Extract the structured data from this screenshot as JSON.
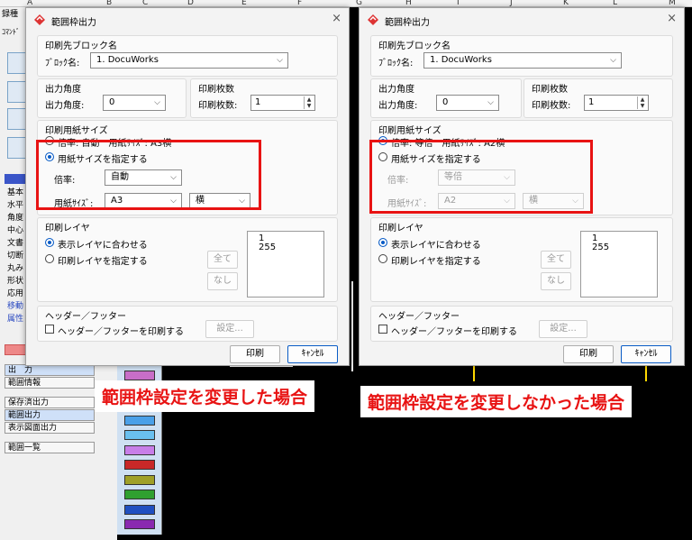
{
  "sheet": {
    "columns": [
      "A",
      "B",
      "C",
      "D",
      "E",
      "F",
      "G",
      "H",
      "I",
      "J",
      "K",
      "L",
      "M"
    ]
  },
  "left_panel": {
    "items": [
      "録種",
      "ｺﾏﾝﾄﾞ",
      "基本",
      "水平",
      "角度",
      "中心",
      "文書",
      "切断",
      "丸み",
      "形状",
      "応用",
      "移動",
      "属性"
    ]
  },
  "side_buttons": {
    "output": "出　力",
    "range_info": "範囲情報",
    "saved_output": "保存済出力",
    "range_output": "範囲出力",
    "display_output": "表示図面出力",
    "range_list": "範囲一覧"
  },
  "color_bars": [
    "#c86ec8",
    "#8a5ae0",
    "#3b82e0",
    "#4aa0e8",
    "#6ac0f0",
    "#c87ee8",
    "#c82828",
    "#a0a028",
    "#30a030",
    "#2050c0",
    "#8a2ab0"
  ],
  "dialogs": [
    {
      "title": "範囲枠出力",
      "close": "×",
      "dest_group": "印刷先ブロック名",
      "block_label": "ﾌﾞﾛｯｸ名:",
      "block_value": "1. DocuWorks",
      "angle_group": "出力角度",
      "angle_label": "出力角度:",
      "angle_value": "0",
      "copies_group": "印刷枚数",
      "copies_label": "印刷枚数:",
      "copies_value": "1",
      "paper_group": "印刷用紙サイズ",
      "opt_auto": "倍率: 自動　用紙ｻｲｽﾞ: A3横",
      "opt_specify": "用紙サイズを指定する",
      "scale_label": "倍率:",
      "scale_value": "自動",
      "size_label": "用紙ｻｲｽﾞ:",
      "size_value": "A3",
      "orient_value": "横",
      "layer_group": "印刷レイヤ",
      "layer_match": "表示レイヤに合わせる",
      "layer_specify": "印刷レイヤを指定する",
      "btn_all": "全て",
      "btn_none": "なし",
      "layers": [
        "1",
        "255"
      ],
      "hf_group": "ヘッダー／フッター",
      "hf_check": "ヘッダー／フッターを印刷する",
      "btn_settings": "設定...",
      "btn_print": "印刷",
      "btn_cancel": "ｷｬﾝｾﾙ",
      "caption": "範囲枠設定を変更した場合"
    },
    {
      "title": "範囲枠出力",
      "close": "×",
      "dest_group": "印刷先ブロック名",
      "block_label": "ﾌﾞﾛｯｸ名:",
      "block_value": "1. DocuWorks",
      "angle_group": "出力角度",
      "angle_label": "出力角度:",
      "angle_value": "0",
      "copies_group": "印刷枚数",
      "copies_label": "印刷枚数:",
      "copies_value": "1",
      "paper_group": "印刷用紙サイズ",
      "opt_auto": "倍率: 等倍　用紙ｻｲｽﾞ: A2横",
      "opt_specify": "用紙サイズを指定する",
      "scale_label": "倍率:",
      "scale_value": "等倍",
      "size_label": "用紙ｻｲｽﾞ:",
      "size_value": "A2",
      "orient_value": "横",
      "layer_group": "印刷レイヤ",
      "layer_match": "表示レイヤに合わせる",
      "layer_specify": "印刷レイヤを指定する",
      "btn_all": "全て",
      "btn_none": "なし",
      "layers": [
        "1",
        "255"
      ],
      "hf_group": "ヘッダー／フッター",
      "hf_check": "ヘッダー／フッターを印刷する",
      "btn_settings": "設定...",
      "btn_print": "印刷",
      "btn_cancel": "ｷｬﾝｾﾙ",
      "caption": "範囲枠設定を変更しなかった場合"
    }
  ]
}
